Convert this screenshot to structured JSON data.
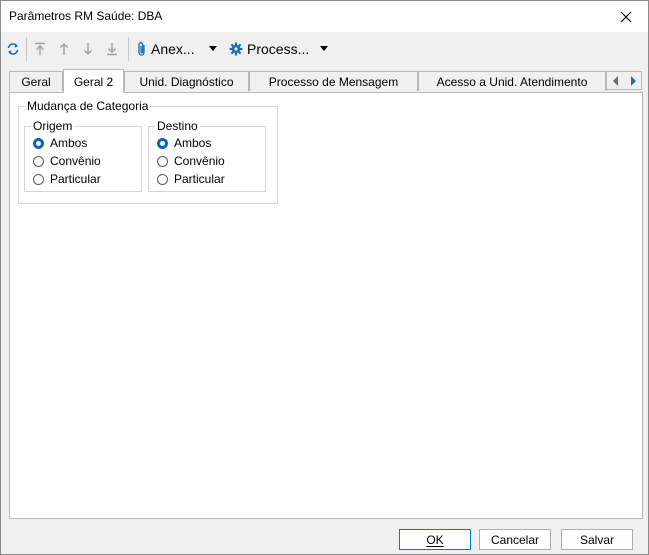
{
  "window": {
    "title": "Parâmetros RM Saúde: DBA"
  },
  "toolbar": {
    "refresh_icon": "refresh-icon",
    "nav_icons": [
      "move-first-icon",
      "move-up-icon",
      "move-down-icon",
      "move-last-icon"
    ],
    "anexos_label": "Anex...",
    "processos_label": "Process..."
  },
  "tabs": [
    {
      "label": "Geral",
      "active": false
    },
    {
      "label": "Geral 2",
      "active": true
    },
    {
      "label": "Unid. Diagnóstico",
      "active": false
    },
    {
      "label": "Processo de Mensagem",
      "active": false
    },
    {
      "label": "Acesso a Unid. Atendimento",
      "active": false
    }
  ],
  "panel": {
    "group_title": "Mudança de Categoria",
    "origem": {
      "title": "Origem",
      "options": [
        "Ambos",
        "Convênio",
        "Particular"
      ],
      "selected": "Ambos"
    },
    "destino": {
      "title": "Destino",
      "options": [
        "Ambos",
        "Convênio",
        "Particular"
      ],
      "selected": "Ambos"
    }
  },
  "footer": {
    "ok_label": "OK",
    "cancel_label": "Cancelar",
    "save_label": "Salvar"
  },
  "colors": {
    "accent": "#0067c0",
    "toolbar_icon": "#1a6fb5"
  }
}
